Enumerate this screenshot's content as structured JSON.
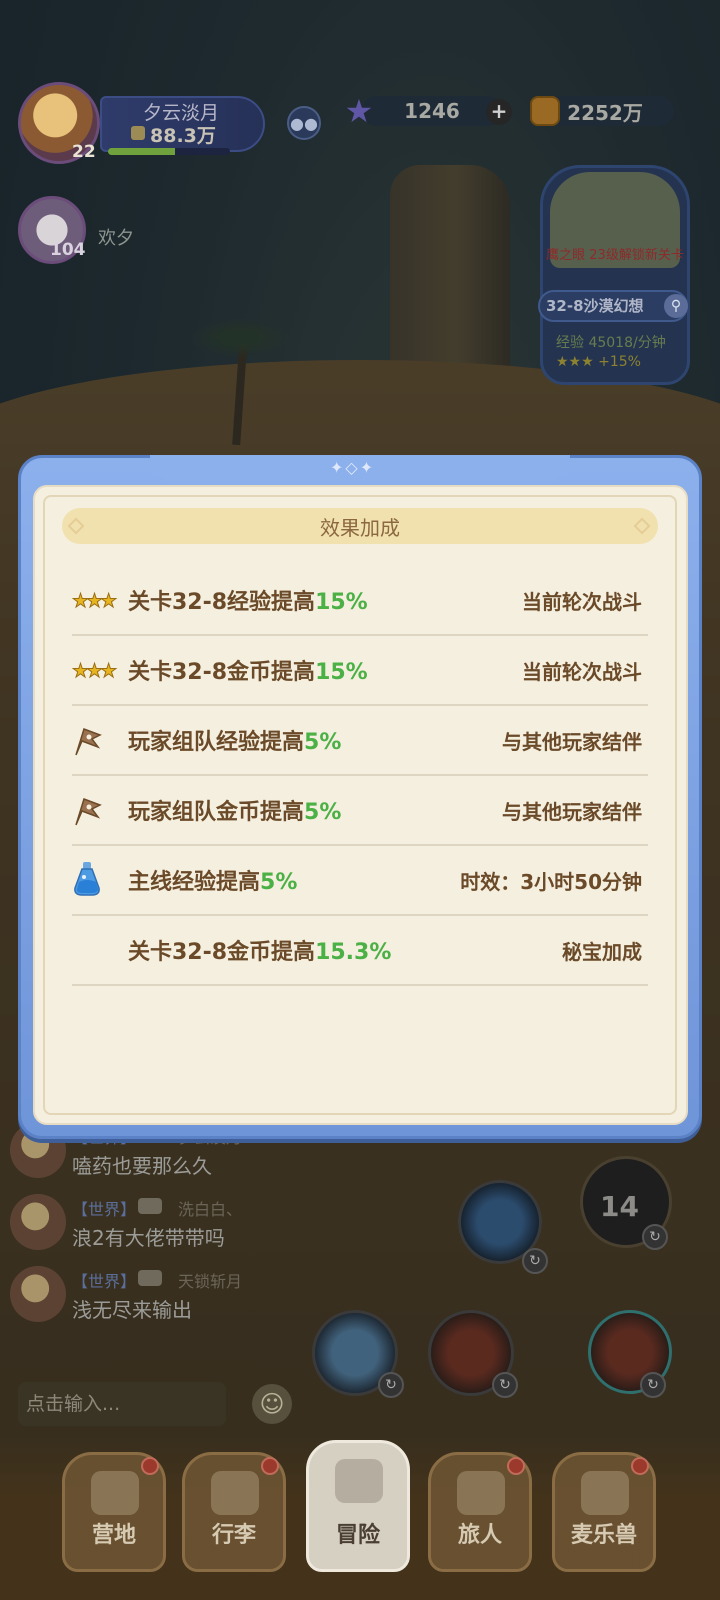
{
  "hud": {
    "player_name": "夕云淡月",
    "player_power": "88.3万",
    "player_level": "22",
    "player_xp_fraction": 0.55,
    "stars_count": "1246",
    "coins": "2252万",
    "partner_level": "104",
    "partner_name": "欢夕"
  },
  "stage_card": {
    "notice": "鹰之眼  23级解锁新关卡",
    "stage_name": "32-8沙漠幻想",
    "exp_rate": "经验 45018/分钟",
    "bonus": "+15%"
  },
  "modal": {
    "title": "效果加成",
    "rows": [
      {
        "icon": "three-stars-icon",
        "label": "关卡32-8经验提高",
        "pct": "15%",
        "source": "当前轮次战斗"
      },
      {
        "icon": "three-stars-icon",
        "label": "关卡32-8金币提高",
        "pct": "15%",
        "source": "当前轮次战斗"
      },
      {
        "icon": "team-flag-icon",
        "label": "玩家组队经验提高",
        "pct": "5%",
        "source": "与其他玩家结伴"
      },
      {
        "icon": "team-flag-icon",
        "label": "玩家组队金币提高",
        "pct": "5%",
        "source": "与其他玩家结伴"
      },
      {
        "icon": "potion-icon",
        "label": "主线经验提高",
        "pct": "5%",
        "source": "时效：3小时50分钟"
      },
      {
        "icon": "none",
        "label": "关卡32-8金币提高",
        "pct": "15.3%",
        "source": "秘宝加成"
      }
    ]
  },
  "chat": {
    "messages": [
      {
        "channel": "【世界】",
        "sender": "夕云淡月",
        "text": "嗑药也要那么久"
      },
      {
        "channel": "【世界】",
        "sender": "洗白白、",
        "text": "浪2有大佬带带吗"
      },
      {
        "channel": "【世界】",
        "sender": "天锁斩月",
        "text": "浅无尽来输出"
      }
    ],
    "input_placeholder": "点击输入..."
  },
  "skills": {
    "countdown": "14"
  },
  "nav": [
    {
      "label": "营地",
      "badge": true
    },
    {
      "label": "行李",
      "badge": true
    },
    {
      "label": "冒险",
      "badge": false,
      "active": true
    },
    {
      "label": "旅人",
      "badge": true
    },
    {
      "label": "麦乐兽",
      "badge": true
    }
  ],
  "colors": {
    "accent_green": "#4bb045",
    "label_brown": "#6a4a28",
    "modal_blue": "#8cb0ec"
  }
}
